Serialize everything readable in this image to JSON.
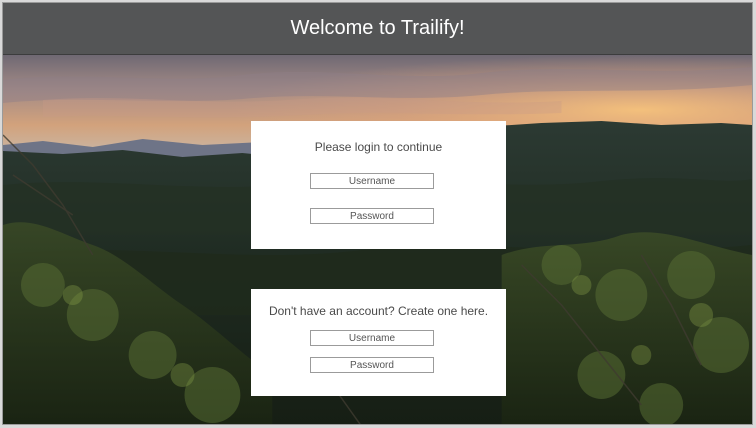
{
  "header": {
    "title": "Welcome to Trailify!"
  },
  "login": {
    "prompt": "Please login to continue",
    "username_placeholder": "Username",
    "password_placeholder": "Password"
  },
  "signup": {
    "prompt": "Don't have an account? Create one here.",
    "username_placeholder": "Username",
    "password_placeholder": "Password"
  },
  "colors": {
    "header_bg": "#545556",
    "header_text": "#ffffff",
    "card_bg": "#ffffff",
    "field_border": "#9b9b9b"
  }
}
